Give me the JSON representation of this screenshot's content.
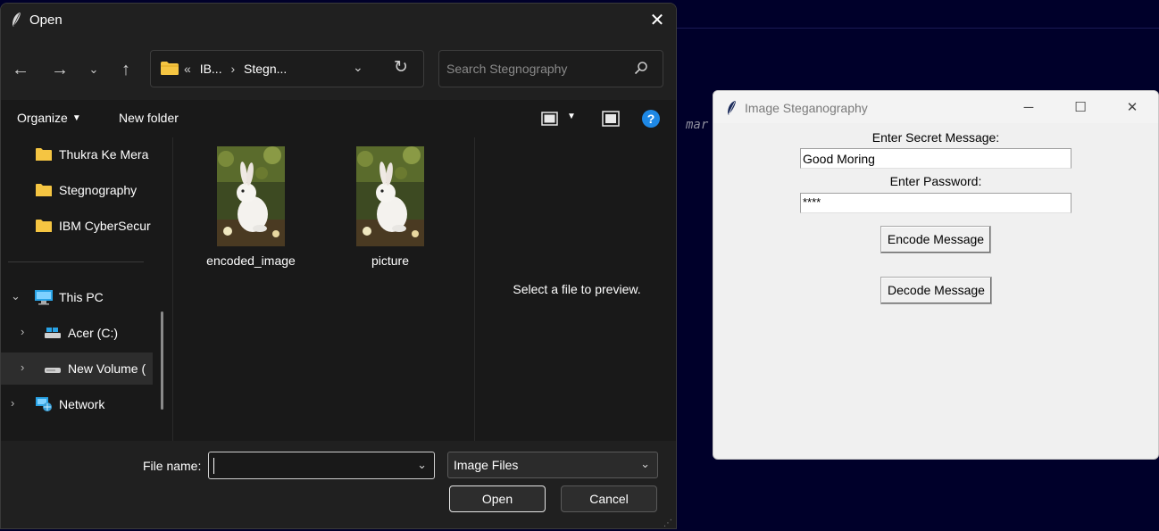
{
  "background": {
    "fragment_text": "mar"
  },
  "open_dialog": {
    "title": "Open",
    "address": {
      "crumb_overflow": "«",
      "crumb_1": "IB...",
      "separator": "›",
      "crumb_2": "Stegn..."
    },
    "search_placeholder": "Search Stegnography",
    "toolbar": {
      "organize": "Organize",
      "new_folder": "New folder"
    },
    "sidebar": [
      {
        "label": "Thukra Ke Mera",
        "icon": "folder-icon"
      },
      {
        "label": "Stegnography",
        "icon": "folder-icon"
      },
      {
        "label": "IBM CyberSecur",
        "icon": "folder-icon"
      },
      {
        "label": "This PC",
        "icon": "computer-icon"
      },
      {
        "label": "Acer (C:)",
        "icon": "drive-icon"
      },
      {
        "label": "New Volume (",
        "icon": "drive-icon"
      },
      {
        "label": "Network",
        "icon": "network-icon"
      }
    ],
    "files": [
      {
        "name": "encoded_image"
      },
      {
        "name": "picture"
      }
    ],
    "preview_message": "Select a file to preview.",
    "footer": {
      "file_name_label": "File name:",
      "file_name_value": "",
      "file_type": "Image Files",
      "open_label": "Open",
      "cancel_label": "Cancel"
    }
  },
  "steg_window": {
    "title": "Image Steganography",
    "secret_label": "Enter Secret Message:",
    "secret_value": "Good Moring",
    "password_label": "Enter Password:",
    "password_value": "****",
    "encode_label": "Encode Message",
    "decode_label": "Decode Message"
  },
  "colors": {
    "desktop_bg": "#00002a",
    "dialog_bg": "#191919",
    "dialog_bar": "#202020",
    "folder_yellow": "#f5c542",
    "help_blue": "#1e88e5",
    "tk_bg": "#f0f0f0"
  }
}
